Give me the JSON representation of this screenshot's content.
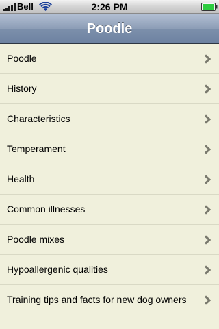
{
  "status_bar": {
    "carrier": "Bell",
    "time": "2:26 PM",
    "signal_icon": "signal-bars-icon",
    "wifi_icon": "wifi-icon",
    "battery_icon": "battery-full-icon",
    "battery_color": "#2ecc40"
  },
  "nav_bar": {
    "title": "Poodle"
  },
  "list": {
    "items": [
      {
        "label": "Poodle"
      },
      {
        "label": "History"
      },
      {
        "label": "Characteristics"
      },
      {
        "label": "Temperament"
      },
      {
        "label": "Health"
      },
      {
        "label": "Common illnesses"
      },
      {
        "label": "Poodle mixes"
      },
      {
        "label": "Hypoallergenic qualities"
      },
      {
        "label": "Training tips and facts for new dog owners"
      }
    ],
    "disclosure_icon": "chevron-right-icon"
  },
  "colors": {
    "list_background": "#f0f0dc",
    "separator": "#d9d9c5",
    "nav_bar": "#8c9db6",
    "chevron": "#7a7a6e"
  }
}
